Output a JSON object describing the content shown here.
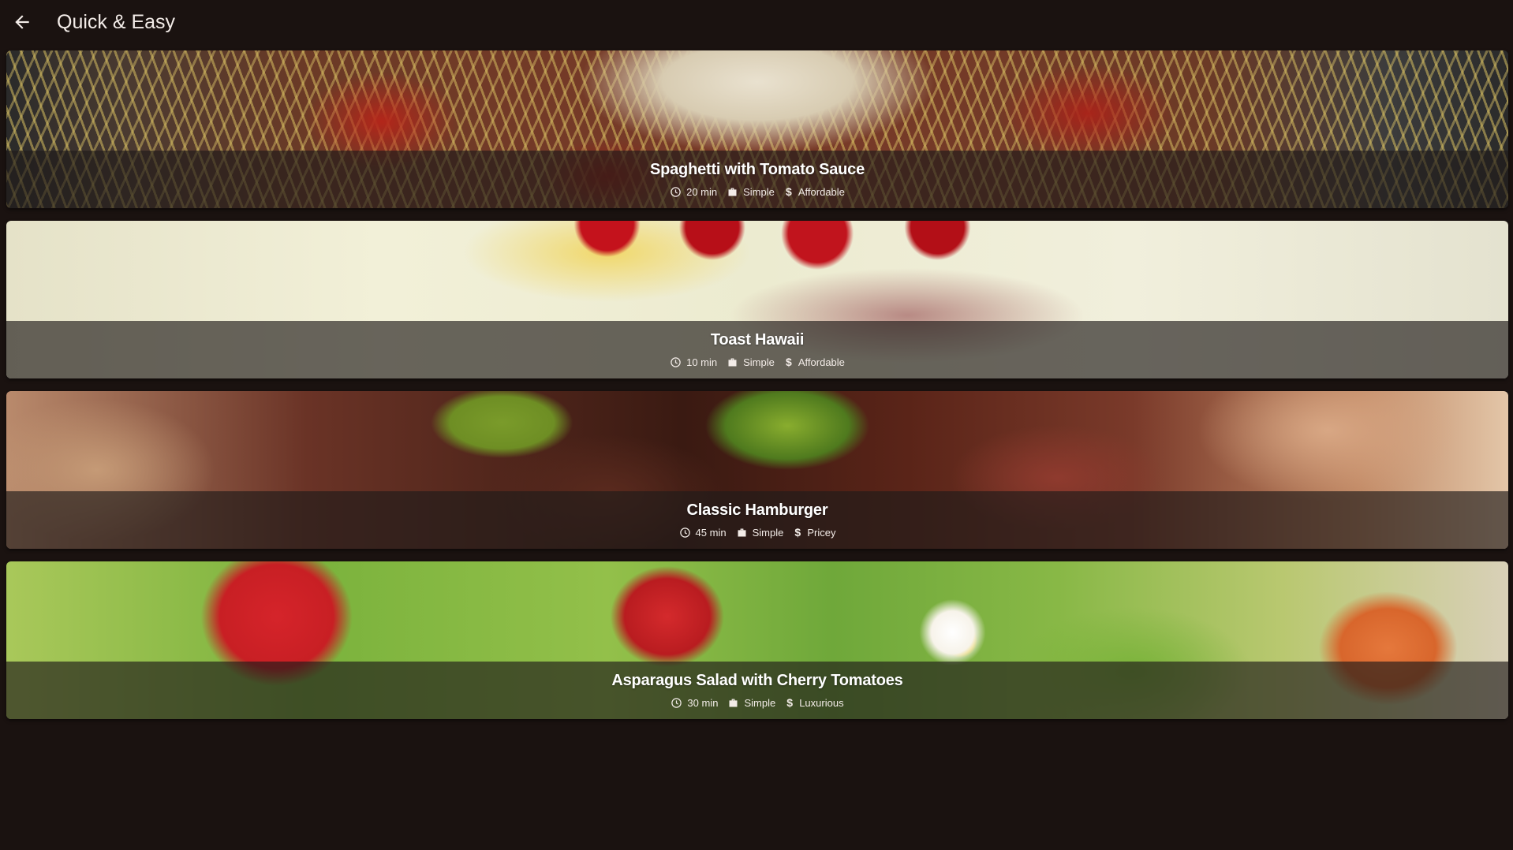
{
  "app_bar": {
    "title": "Quick & Easy",
    "back_icon": "arrow-back-icon"
  },
  "meals": [
    {
      "title": "Spaghetti with Tomato Sauce",
      "duration": "20 min",
      "complexity": "Simple",
      "affordability": "Affordable"
    },
    {
      "title": "Toast Hawaii",
      "duration": "10 min",
      "complexity": "Simple",
      "affordability": "Affordable"
    },
    {
      "title": "Classic Hamburger",
      "duration": "45 min",
      "complexity": "Simple",
      "affordability": "Pricey"
    },
    {
      "title": "Asparagus Salad with Cherry Tomatoes",
      "duration": "30 min",
      "complexity": "Simple",
      "affordability": "Luxurious"
    }
  ],
  "icons": {
    "duration": "schedule-icon",
    "complexity": "work-icon",
    "affordability": "attach-money-icon"
  },
  "colors": {
    "background": "#1a1210",
    "overlay": "#201c1a",
    "text": "#ffffff"
  }
}
